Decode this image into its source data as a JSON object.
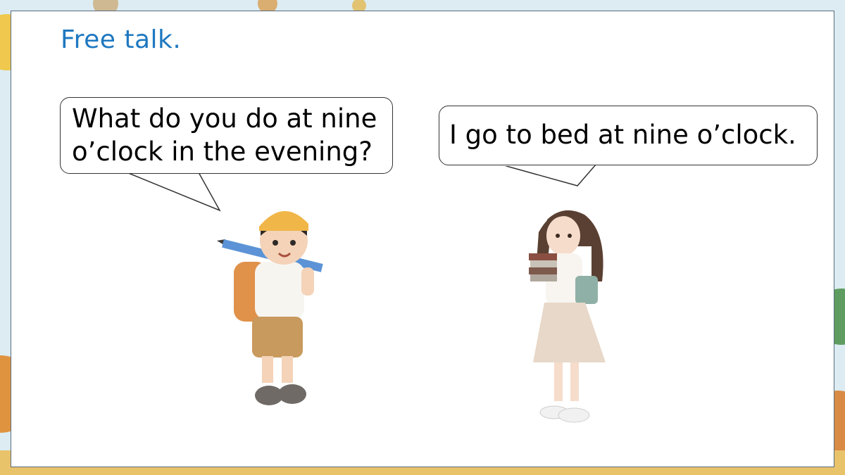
{
  "slide": {
    "title": "Free talk."
  },
  "dialogue": {
    "boy_line_1": "What do you do at nine",
    "boy_line_2": "o’clock in the evening?",
    "girl_line": "I go to bed at nine o’clock."
  },
  "colors": {
    "title": "#1f78c0",
    "card_border": "#5a6b7c",
    "bubble_border": "#333333"
  }
}
